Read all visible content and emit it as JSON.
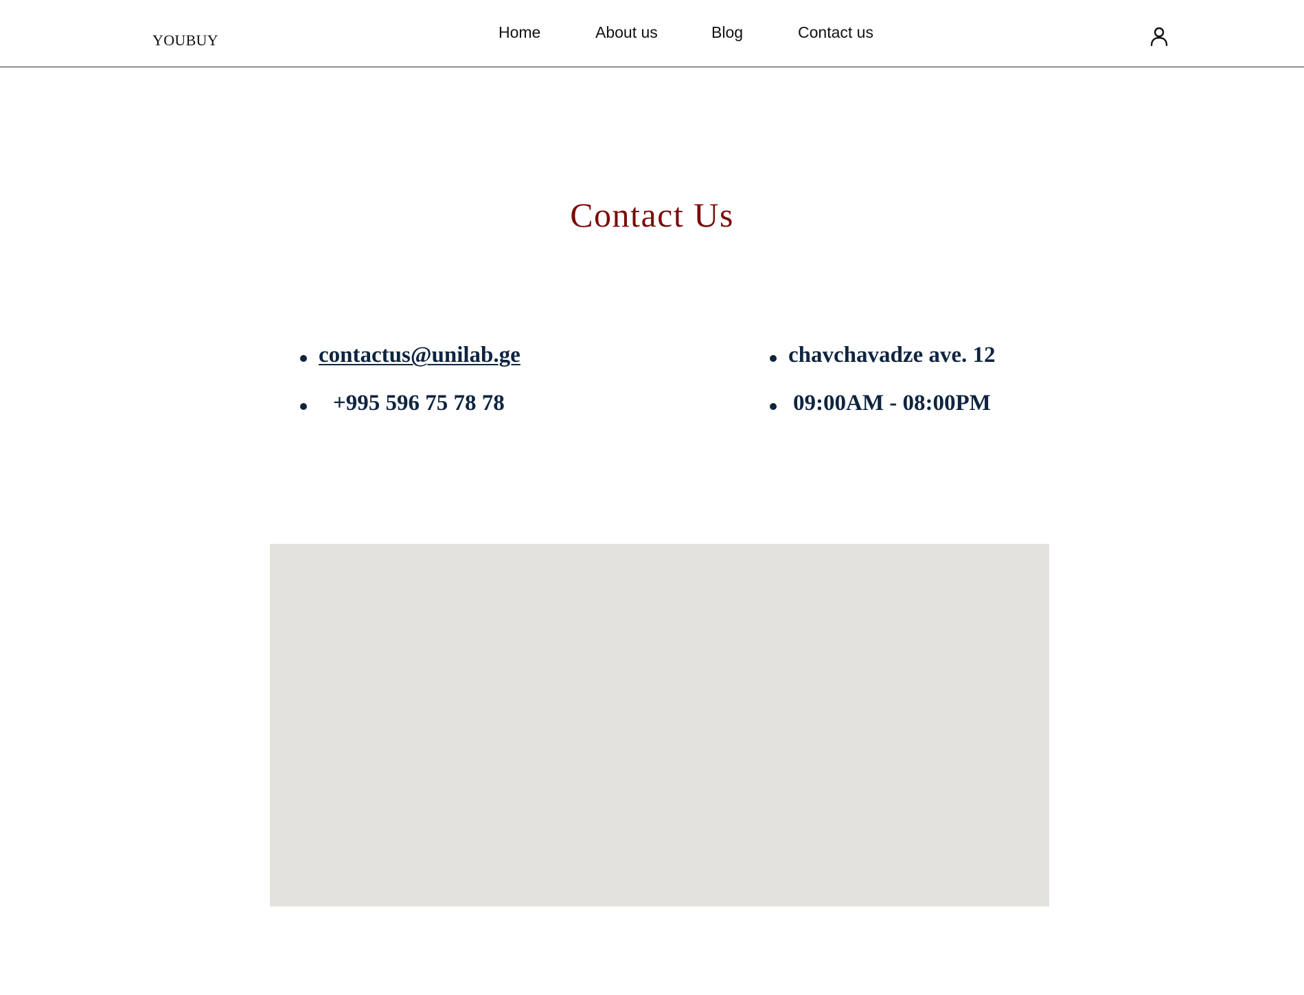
{
  "header": {
    "logo": "YOUBUY",
    "nav": [
      {
        "label": "Home"
      },
      {
        "label": "About us"
      },
      {
        "label": "Blog"
      },
      {
        "label": "Contact us"
      }
    ],
    "user_icon": "user-icon"
  },
  "main": {
    "title": "Contact Us",
    "contact": {
      "email": "contactus@unilab.ge",
      "phone": "+995 596 75 78 78",
      "address": "chavchavadze ave. 12",
      "hours": "09:00AM - 08:00PM"
    },
    "map": {
      "color": "#e3e2df"
    }
  },
  "colors": {
    "title": "#7d0a0a",
    "info_text": "#0f2440",
    "header_border": "#2b2b2b"
  }
}
